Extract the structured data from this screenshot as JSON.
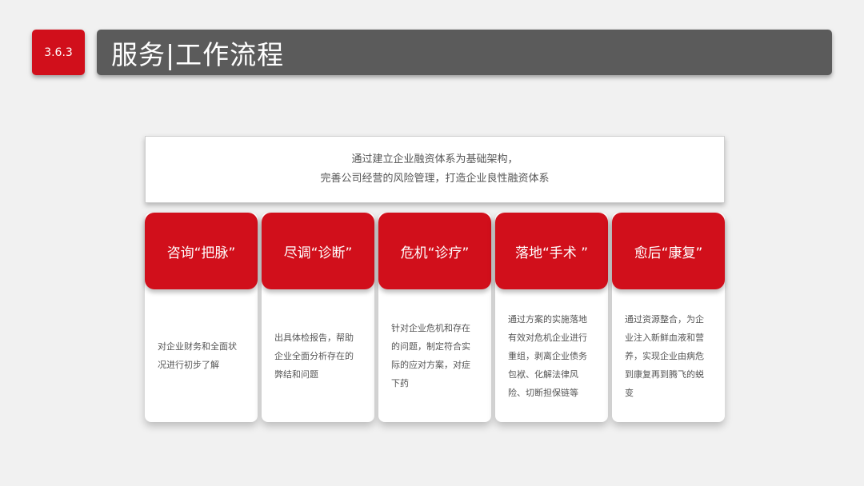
{
  "header": {
    "section_number": "3.6.3",
    "title": "服务|工作流程"
  },
  "intro": {
    "line1": "通过建立企业融资体系为基础架构，",
    "line2": "完善公司经营的风险管理，打造企业良性融资体系"
  },
  "steps": [
    {
      "title": "咨询“把脉”",
      "description": "对企业财务和全面状况进行初步了解"
    },
    {
      "title": "尽调“诊断”",
      "description": "出具体检报告，帮助企业全面分析存在的弊结和问题"
    },
    {
      "title": "危机“诊疗”",
      "description": "针对企业危机和存在的问题，制定符合实际的应对方案，对症下药"
    },
    {
      "title": "落地“手术 ”",
      "description": "通过方案的实施落地有效对危机企业进行重组，剥离企业债务包袱、化解法律风险、切断担保链等"
    },
    {
      "title": "愈后“康复”",
      "description": "通过资源整合，为企业注入新鲜血液和营养，实现企业由病危到康复再到腾飞的蜕变"
    }
  ],
  "colors": {
    "accent": "#d10f1b",
    "title_bar": "#5b5b5b",
    "background": "#f1f1f1"
  }
}
